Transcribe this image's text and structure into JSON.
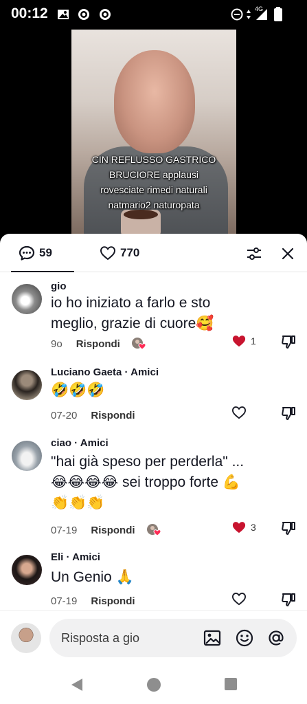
{
  "status": {
    "time": "00:12",
    "network": "4G"
  },
  "video": {
    "caption_lines": [
      "CIN REFLUSSO GASTRICO",
      "BRUCIORE applausi",
      "rovesciate rimedi naturali",
      "natmario2 naturopata"
    ]
  },
  "sheet": {
    "tabs": {
      "comments_count": "59",
      "likes_count": "770"
    },
    "icons": {
      "comments": "speech-bubble-icon",
      "likes": "heart-outline-icon",
      "filter": "sliders-icon",
      "close": "close-x-icon"
    }
  },
  "comments": [
    {
      "username": "gio",
      "text_lines": [
        "io ho iniziato a farlo e sto",
        "meglio, grazie di cuore🥰"
      ],
      "date": "9o",
      "reply": "Rispondi",
      "creator_liked": true,
      "likes": "1",
      "liked": true
    },
    {
      "username": "Luciano Gaeta · Amici",
      "text_lines": [
        "🤣🤣🤣"
      ],
      "date": "07-20",
      "reply": "Rispondi",
      "creator_liked": false,
      "likes": "",
      "liked": false
    },
    {
      "username": "ciao · Amici",
      "text_lines": [
        "\"hai già speso per perderla\" ...",
        "😂😂😂😂 sei troppo forte 💪",
        "👏👏👏"
      ],
      "date": "07-19",
      "reply": "Rispondi",
      "creator_liked": true,
      "likes": "3",
      "liked": true
    },
    {
      "username": "Eli · Amici",
      "text_lines": [
        "Un Genio 🙏"
      ],
      "date": "07-19",
      "reply": "Rispondi",
      "creator_liked": false,
      "likes": "",
      "liked": false
    }
  ],
  "reply_bar": {
    "placeholder": "Risposta a gio",
    "icons": [
      "image-icon",
      "emoji-icon",
      "mention-icon"
    ]
  },
  "colors": {
    "accent_like": "#d6173a",
    "text": "#161823",
    "muted": "#555555"
  }
}
